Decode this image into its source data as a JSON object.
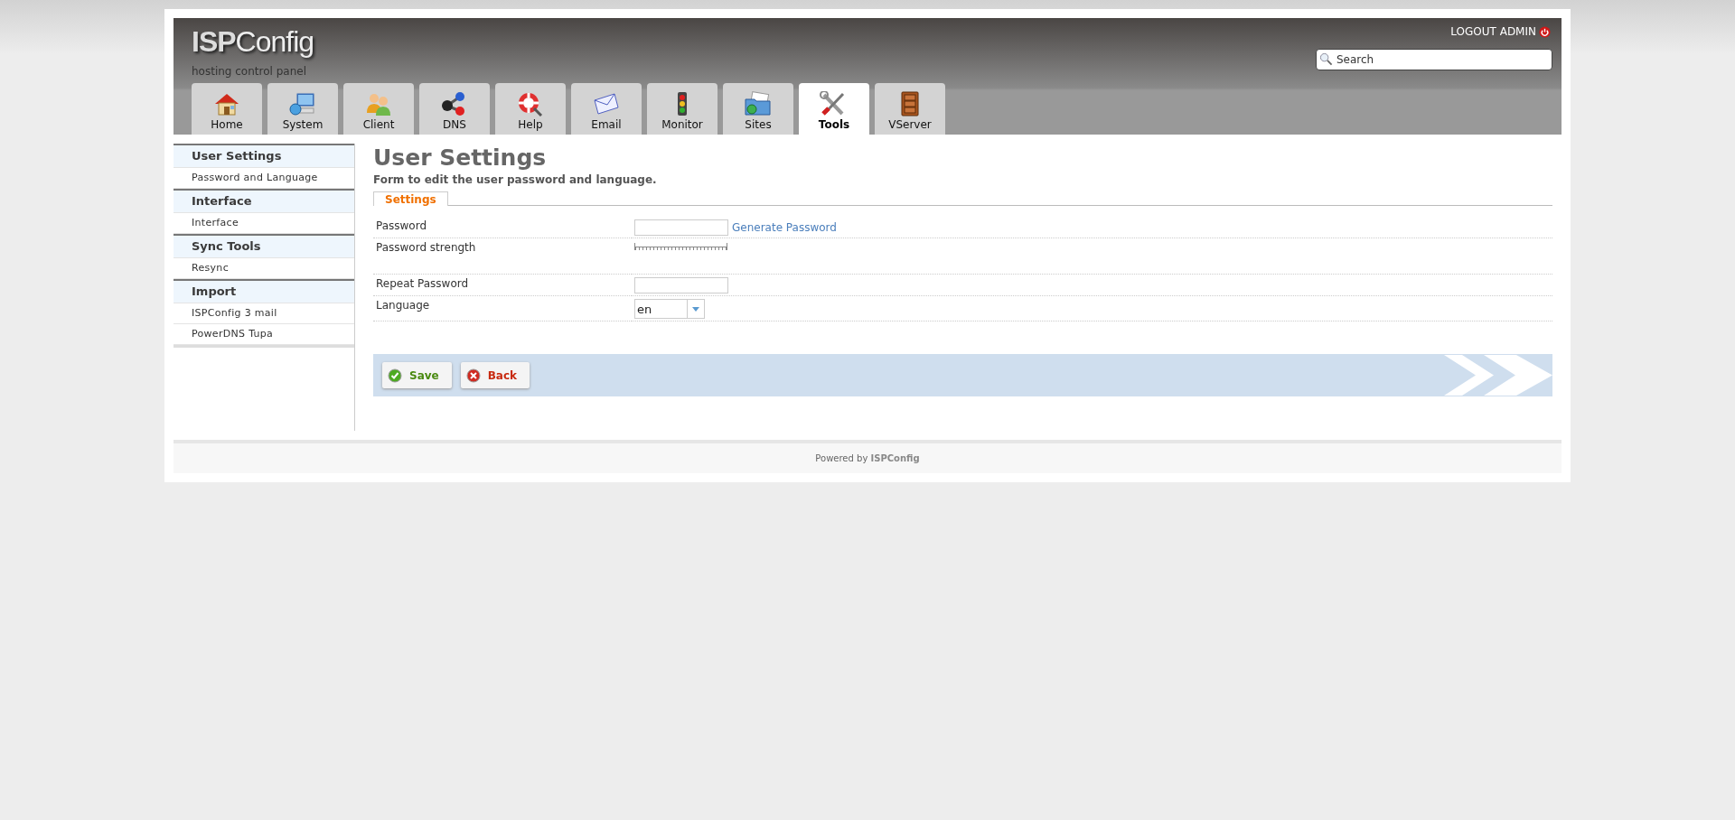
{
  "header": {
    "logo": "**ISP**Config",
    "tagline": "hosting control panel",
    "logout": "LOGOUT ADMIN",
    "search": {
      "placeholder": "Search"
    }
  },
  "tabs": [
    {
      "label": "Home",
      "selected": false
    },
    {
      "label": "System",
      "selected": false
    },
    {
      "label": "Client",
      "selected": false
    },
    {
      "label": "DNS",
      "selected": false
    },
    {
      "label": "Help",
      "selected": false
    },
    {
      "label": "Email",
      "selected": false
    },
    {
      "label": "Monitor",
      "selected": false
    },
    {
      "label": "Sites",
      "selected": false
    },
    {
      "label": "Tools",
      "selected": true
    },
    {
      "label": "VServer",
      "selected": false
    }
  ],
  "sidebar": {
    "groups": [
      {
        "title": "User Settings",
        "items": [
          "Password and Language"
        ]
      },
      {
        "title": "Interface",
        "items": [
          "Interface"
        ]
      },
      {
        "title": "Sync Tools",
        "items": [
          "Resync"
        ]
      },
      {
        "title": "Import",
        "items": [
          "ISPConfig 3 mail",
          "PowerDNS Tupa"
        ]
      }
    ]
  },
  "form": {
    "title": "User Settings",
    "description": "Form to edit the user password and language.",
    "tabs": [
      {
        "label": "Settings",
        "selected": true
      }
    ],
    "fields": [
      {
        "kind": "password",
        "label": "Password",
        "link": "Generate Password"
      },
      {
        "kind": "strength",
        "label": "Password strength",
        "level": 0
      },
      {
        "kind": "password",
        "label": "Repeat Password"
      },
      {
        "kind": "select",
        "label": "Language",
        "value": "en"
      }
    ],
    "buttons": [
      {
        "kind": "save",
        "label": "Save"
      },
      {
        "kind": "back",
        "label": "Back"
      }
    ]
  },
  "footer": "Powered by **ISPConfig**"
}
